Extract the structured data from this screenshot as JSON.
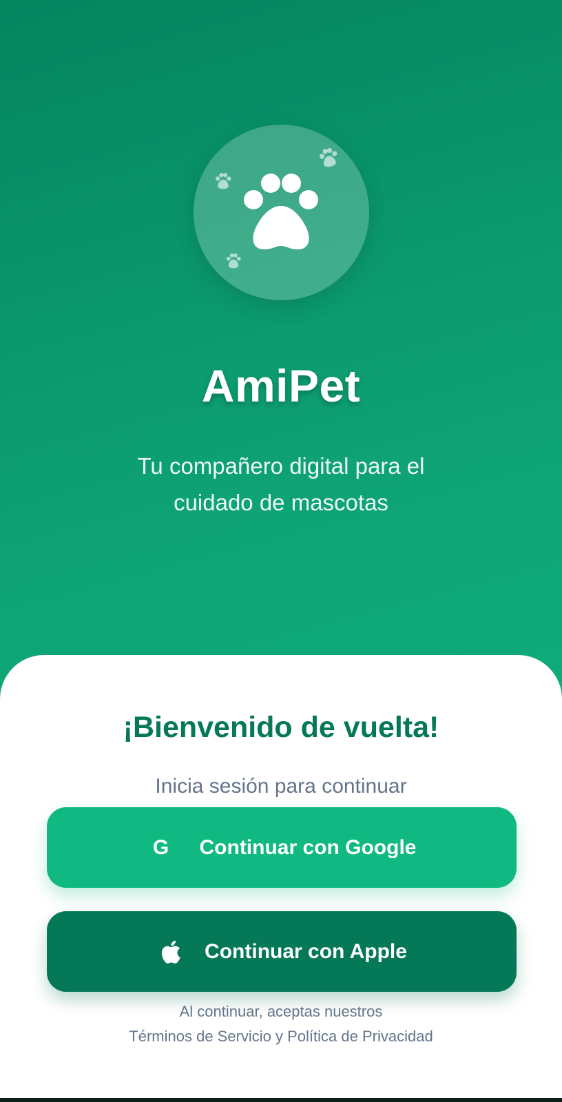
{
  "app": {
    "title": "AmiPet",
    "subtitle": "Tu compañero digital para el cuidado de mascotas",
    "logo_icon": "paw-icon"
  },
  "sheet": {
    "welcome": "¡Bienvenido de vuelta!",
    "prompt": "Inicia sesión para continuar",
    "google_button": {
      "icon": "G",
      "label": "Continuar con Google"
    },
    "apple_button": {
      "icon": "apple-icon",
      "label": "Continuar con Apple"
    },
    "legal_line1": "Al continuar, aceptas nuestros",
    "legal_line2": "Términos de Servicio y Política de Privacidad"
  },
  "colors": {
    "gradient_start": "#05855f",
    "gradient_end": "#10b883",
    "google_button": "#10b981",
    "apple_button": "#047857",
    "welcome_text": "#047857",
    "muted_text": "#64748b"
  }
}
